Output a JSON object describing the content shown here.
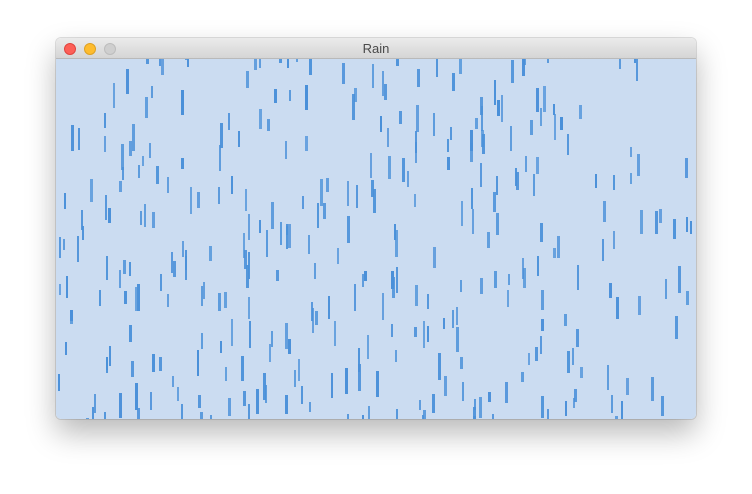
{
  "window": {
    "title": "Rain"
  },
  "traffic_lights": {
    "close_color": "#fd5f57",
    "close_border": "#e0443e",
    "minimize_color": "#febc2e",
    "minimize_border": "#dea123",
    "zoom_color": "#cfcfcf",
    "zoom_border": "#bdbdbd"
  },
  "canvas": {
    "background_color": "#cbdcf1",
    "drop_color": "#4a90d9"
  }
}
